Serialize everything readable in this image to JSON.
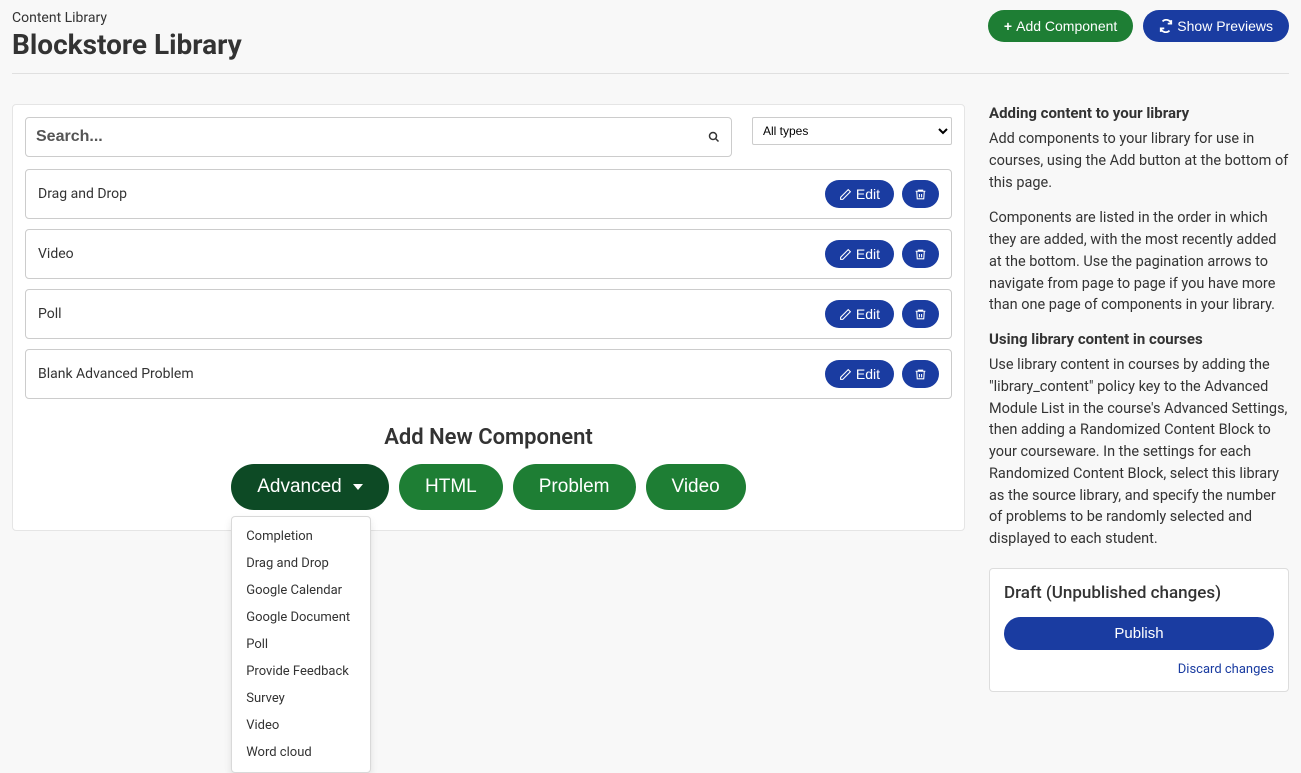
{
  "header": {
    "eyebrow": "Content Library",
    "title": "Blockstore Library",
    "add_component_label": "Add Component",
    "show_previews_label": "Show Previews"
  },
  "search": {
    "placeholder": "Search...",
    "type_filter": "All types"
  },
  "edit_label": "Edit",
  "components": [
    {
      "title": "Drag and Drop"
    },
    {
      "title": "Video"
    },
    {
      "title": "Poll"
    },
    {
      "title": "Blank Advanced Problem"
    }
  ],
  "add_new": {
    "heading": "Add New Component",
    "types": {
      "advanced": "Advanced",
      "html": "HTML",
      "problem": "Problem",
      "video": "Video"
    },
    "advanced_menu": [
      "Completion",
      "Drag and Drop",
      "Google Calendar",
      "Google Document",
      "Poll",
      "Provide Feedback",
      "Survey",
      "Video",
      "Word cloud"
    ]
  },
  "help": {
    "h1": "Adding content to your library",
    "p1": "Add components to your library for use in courses, using the Add button at the bottom of this page.",
    "p2": "Components are listed in the order in which they are added, with the most recently added at the bottom. Use the pagination arrows to navigate from page to page if you have more than one page of components in your library.",
    "h2": "Using library content in courses",
    "p3": "Use library content in courses by adding the \"library_content\" policy key to the Advanced Module List in the course's Advanced Settings, then adding a Randomized Content Block to your courseware. In the settings for each Randomized Content Block, select this library as the source library, and specify the number of problems to be randomly selected and displayed to each student."
  },
  "draft": {
    "title": "Draft (Unpublished changes)",
    "publish": "Publish",
    "discard": "Discard changes"
  }
}
